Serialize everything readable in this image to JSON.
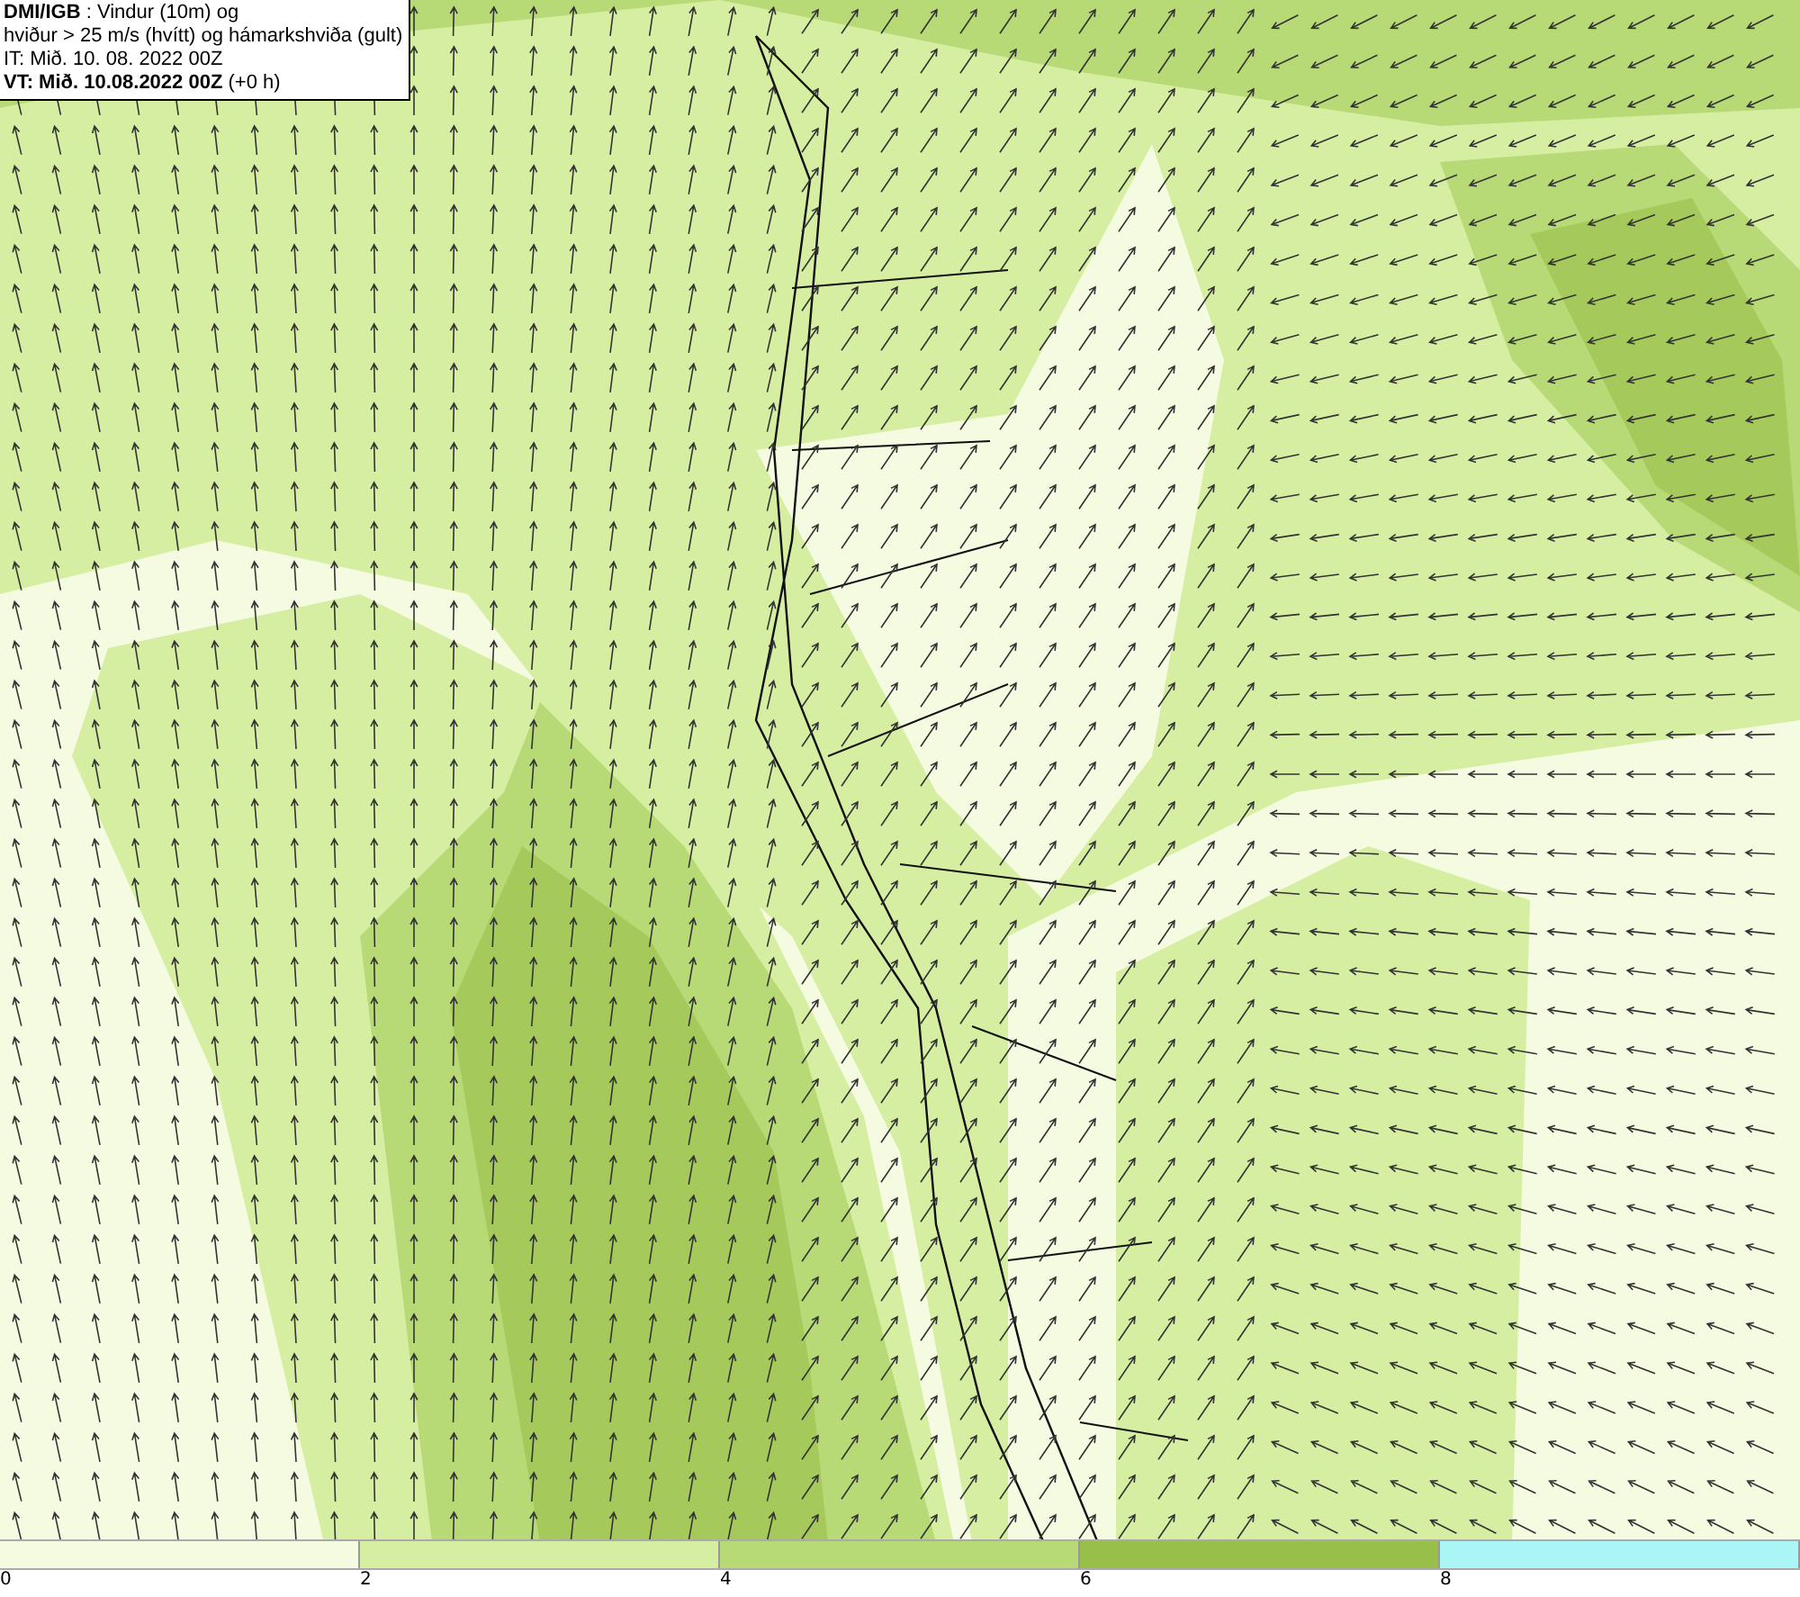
{
  "title_box": {
    "lines": [
      "**DMI/IGB** : Vindur (10m) og",
      "hviður > 25 m/s (hvítt) og hámarkshviða (gult)",
      "IT: Mið. 10. 08. 2022 00Z",
      "**VT: Mið. 10.08.2022 00Z** (+0 h)"
    ]
  },
  "legend": {
    "segments": [
      {
        "label": "0",
        "color": "#f4fbe0"
      },
      {
        "label": "2",
        "color": "#d6eea2"
      },
      {
        "label": "4",
        "color": "#b8da76"
      },
      {
        "label": "6",
        "color": "#97bf4a"
      },
      {
        "label": "8",
        "color": "#aaf6f6"
      }
    ]
  }
}
